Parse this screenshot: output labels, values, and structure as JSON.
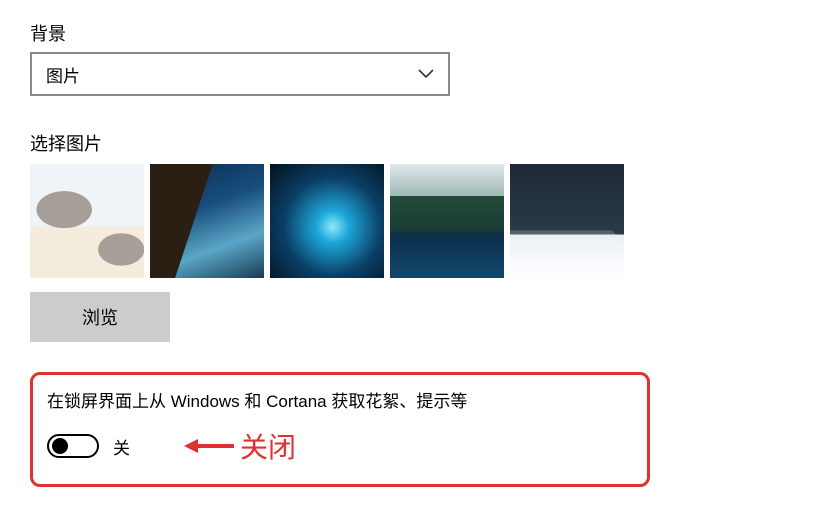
{
  "background": {
    "label": "背景",
    "selected": "图片"
  },
  "picture_picker": {
    "label": "选择图片",
    "browse": "浏览"
  },
  "tips_toggle": {
    "label": "在锁屏界面上从 Windows 和 Cortana 获取花絮、提示等",
    "state": "关"
  },
  "annotation": {
    "text": "关闭"
  }
}
